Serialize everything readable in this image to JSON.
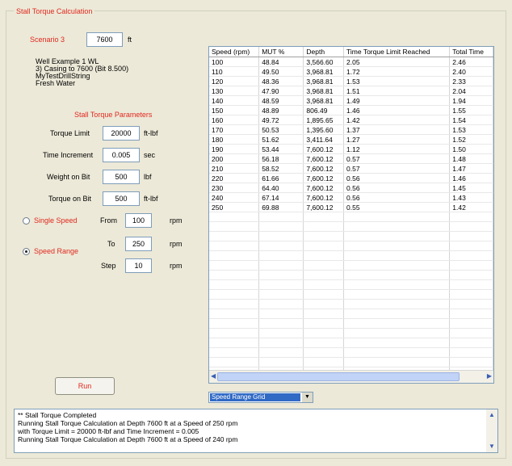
{
  "group_title": "Stall Torque Calculation",
  "scenario": {
    "label": "Scenario 3",
    "value": "7600",
    "unit": "ft"
  },
  "well_info": [
    "Well Example 1 WL",
    "3) Casing to 7600 (Bit 8.500)",
    "MyTestDrillString",
    "Fresh Water"
  ],
  "params": {
    "heading": "Stall Torque Parameters",
    "torque_limit": {
      "label": "Torque Limit",
      "value": "20000",
      "unit": "ft-lbf"
    },
    "time_increment": {
      "label": "Time Increment",
      "value": "0.005",
      "unit": "sec"
    },
    "weight_on_bit": {
      "label": "Weight on Bit",
      "value": "500",
      "unit": "lbf"
    },
    "torque_on_bit": {
      "label": "Torque on Bit",
      "value": "500",
      "unit": "ft-lbf"
    }
  },
  "mode": {
    "single_label": "Single Speed",
    "range_label": "Speed Range",
    "selected": "range"
  },
  "speed": {
    "from": {
      "label": "From",
      "value": "100",
      "unit": "rpm"
    },
    "to": {
      "label": "To",
      "value": "250",
      "unit": "rpm"
    },
    "step": {
      "label": "Step",
      "value": "10",
      "unit": "rpm"
    }
  },
  "run_label": "Run",
  "grid": {
    "columns": [
      "Speed (rpm)",
      "MUT %",
      "Depth",
      "Time Torque Limit Reached",
      "Total Time"
    ],
    "rows": [
      [
        "100",
        "48.84",
        "3,566.60",
        "2.05",
        "2.46"
      ],
      [
        "110",
        "49.50",
        "3,968.81",
        "1.72",
        "2.40"
      ],
      [
        "120",
        "48.36",
        "3,968.81",
        "1.53",
        "2.33"
      ],
      [
        "130",
        "47.90",
        "3,968.81",
        "1.51",
        "2.04"
      ],
      [
        "140",
        "48.59",
        "3,968.81",
        "1.49",
        "1.94"
      ],
      [
        "150",
        "48.89",
        "806.49",
        "1.46",
        "1.55"
      ],
      [
        "160",
        "49.72",
        "1,895.65",
        "1.42",
        "1.54"
      ],
      [
        "170",
        "50.53",
        "1,395.60",
        "1.37",
        "1.53"
      ],
      [
        "180",
        "51.62",
        "3,411.64",
        "1.27",
        "1.52"
      ],
      [
        "190",
        "53.44",
        "7,600.12",
        "1.12",
        "1.50"
      ],
      [
        "200",
        "56.18",
        "7,600.12",
        "0.57",
        "1.48"
      ],
      [
        "210",
        "58.52",
        "7,600.12",
        "0.57",
        "1.47"
      ],
      [
        "220",
        "61.66",
        "7,600.12",
        "0.56",
        "1.46"
      ],
      [
        "230",
        "64.40",
        "7,600.12",
        "0.56",
        "1.45"
      ],
      [
        "240",
        "67.14",
        "7,600.12",
        "0.56",
        "1.43"
      ],
      [
        "250",
        "69.88",
        "7,600.12",
        "0.55",
        "1.42"
      ]
    ]
  },
  "view_select": "Speed Range Grid",
  "log_lines": [
    "** Stall Torque Completed",
    "Running Stall Torque Calculation at Depth 7600 ft at a Speed of 250 rpm",
    "    with Torque Limit = 20000 ft-lbf and Time Increment = 0.005",
    "Running Stall Torque Calculation at Depth 7600 ft at a Speed of 240 rpm"
  ]
}
